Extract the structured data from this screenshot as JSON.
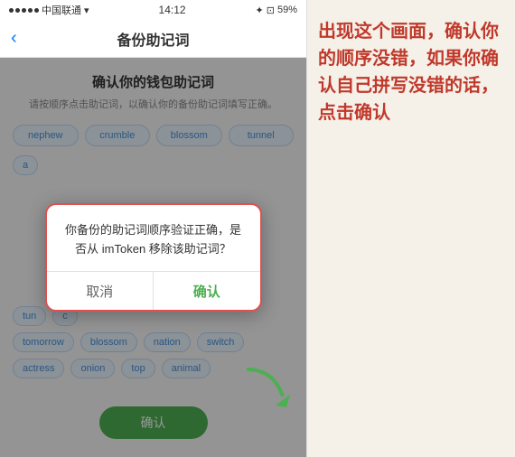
{
  "status_bar": {
    "carrier": "中国联通",
    "time": "14:12",
    "battery": "59%"
  },
  "nav": {
    "back_icon": "‹",
    "title": "备份助记词"
  },
  "page": {
    "title": "确认你的钱包助记词",
    "desc": "请按顺序点击助记词，以确认你的备份助记词填写正确。",
    "words_row1": [
      "nephew",
      "crumble",
      "blossom",
      "tunnel"
    ],
    "words_row2_partial": [
      "a"
    ],
    "words_bottom_row1": [
      "tun",
      "c"
    ],
    "words_bottom_row2": [
      "tomorrow",
      "blossom",
      "nation",
      "switch"
    ],
    "words_bottom_row3": [
      "actress",
      "onion",
      "top",
      "animal"
    ],
    "confirm_btn": "确认"
  },
  "dialog": {
    "message": "你备份的助记词顺序验证正确，是否从 imToken 移除该助记词？",
    "cancel_label": "取消",
    "ok_label": "确认"
  },
  "annotation": {
    "text": "出现这个画面，确认你的顺序没错，如果你确认自己拼写没错的话，点击确认"
  }
}
